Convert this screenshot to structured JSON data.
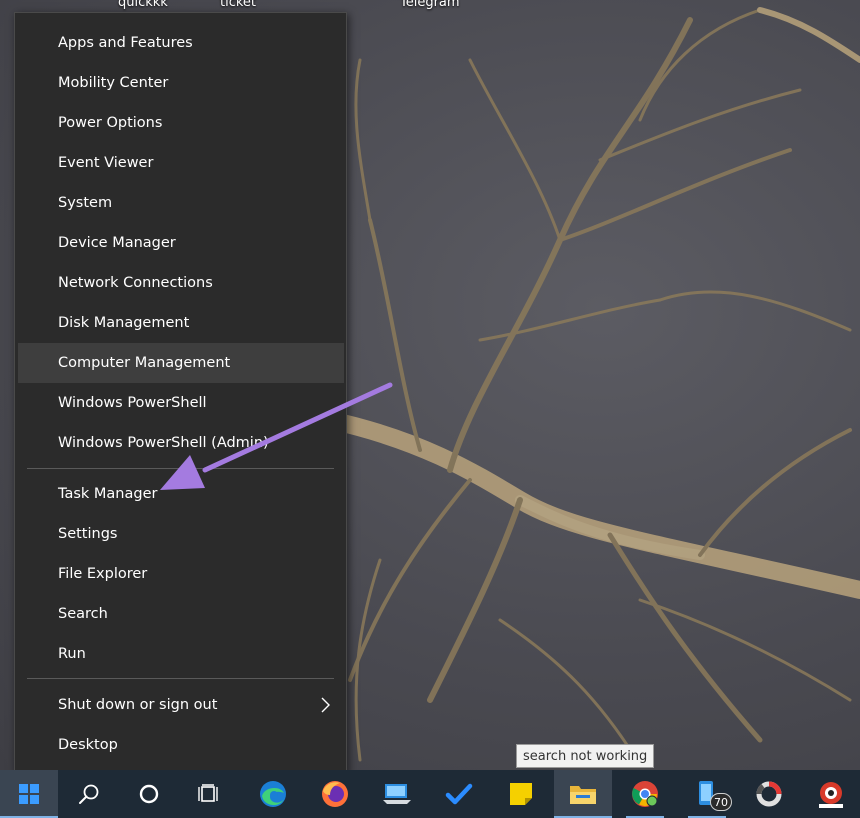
{
  "desktop": {
    "icon_labels": [
      "quickkk",
      "ticket",
      "Telegram"
    ]
  },
  "menu": {
    "items": [
      {
        "label": "Apps and Features"
      },
      {
        "label": "Mobility Center"
      },
      {
        "label": "Power Options"
      },
      {
        "label": "Event Viewer"
      },
      {
        "label": "System"
      },
      {
        "label": "Device Manager"
      },
      {
        "label": "Network Connections"
      },
      {
        "label": "Disk Management"
      },
      {
        "label": "Computer Management"
      },
      {
        "label": "Windows PowerShell"
      },
      {
        "label": "Windows PowerShell (Admin)"
      },
      {
        "label": "Task Manager"
      },
      {
        "label": "Settings"
      },
      {
        "label": "File Explorer"
      },
      {
        "label": "Search"
      },
      {
        "label": "Run"
      },
      {
        "label": "Shut down or sign out"
      },
      {
        "label": "Desktop"
      }
    ],
    "highlighted_item": "Computer Management"
  },
  "tooltip": {
    "text": "search not working"
  },
  "taskbar": {
    "buttons": [
      {
        "icon": "windows-start-icon"
      },
      {
        "icon": "search-icon"
      },
      {
        "icon": "cortana-icon"
      },
      {
        "icon": "task-view-icon"
      },
      {
        "icon": "edge-icon"
      },
      {
        "icon": "firefox-icon"
      },
      {
        "icon": "remote-desktop-icon"
      },
      {
        "icon": "todo-check-icon"
      },
      {
        "icon": "sticky-notes-icon"
      },
      {
        "icon": "file-explorer-icon"
      },
      {
        "icon": "chrome-icon"
      },
      {
        "icon": "your-phone-icon",
        "badge": "70"
      },
      {
        "icon": "progress-ring-icon"
      },
      {
        "icon": "photoscape-icon"
      }
    ]
  },
  "colors": {
    "menu_bg": "#2b2b2b",
    "menu_highlight": "#3e3e3e",
    "taskbar_bg": "#1e2a36",
    "annotation_arrow": "#a47be0"
  }
}
